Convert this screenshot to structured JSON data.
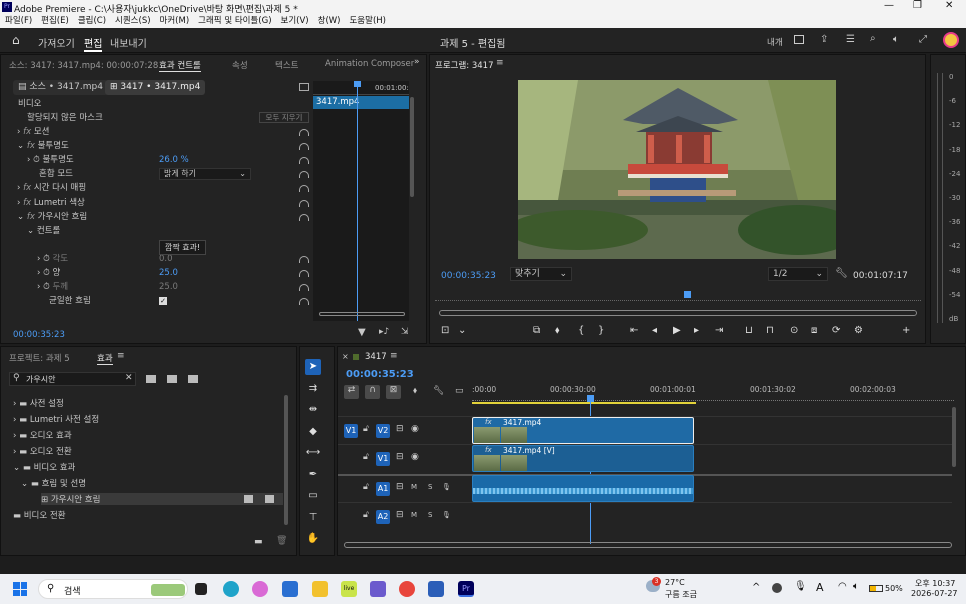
{
  "window": {
    "title": "Adobe Premiere - C:\\사용자\\jukkc\\OneDrive\\바탕 화면\\편집\\과제 5 *"
  },
  "menu": [
    "파일(F)",
    "편집(E)",
    "클립(C)",
    "시퀀스(S)",
    "마커(M)",
    "그래픽 및 타이틀(G)",
    "보기(V)",
    "창(W)",
    "도움말(H)"
  ],
  "header": {
    "nav": [
      "가져오기",
      "편집",
      "내보내기"
    ],
    "project_title": "과제 5 - 편집됨",
    "share": "내개"
  },
  "effect_controls": {
    "tabs": [
      "소스: 3417: 3417.mp4: 00:00:07:28",
      "효과 컨트롤",
      "속성",
      "텍스트",
      "Animation Composer"
    ],
    "source_tab": "소스 • 3417.mp4",
    "seq_tab": "3417 • 3417.mp4",
    "clip_label": "3417.mp4",
    "timecode_mini": "00:01:00:",
    "section": "비디오",
    "unassigned": "할당되지 않은 마스크",
    "remove_btn": "모두 지우기",
    "rows": [
      {
        "label": "모션",
        "fx": true
      },
      {
        "label": "불투명도",
        "fx": true
      },
      {
        "label": "불투명도",
        "value": "26.0 %"
      },
      {
        "label": "혼합 모드",
        "value": "밝게 하기"
      },
      {
        "label": "시간 다시 매핑",
        "fx": true
      },
      {
        "label": "Lumetri 색상",
        "fx": true
      },
      {
        "label": "가우시안 흐림",
        "fx": true
      },
      {
        "label": "컨트롤"
      },
      {
        "label": "각도",
        "value": "0.0"
      },
      {
        "label": "양",
        "value": "25.0"
      },
      {
        "label": "두께",
        "value": "25.0"
      },
      {
        "label": "균일한 흐림",
        "value": ""
      }
    ],
    "effect_button": "깜짝 효과!",
    "timecode": "00:00:35:23"
  },
  "program": {
    "title": "프로그램: 3417",
    "timecode": "00:00:35:23",
    "fit": "맞추기",
    "res": "1/2",
    "duration": "00:01:07:17",
    "meter": [
      "0",
      "-6",
      "-12",
      "-18",
      "-24",
      "-30",
      "-36",
      "-42",
      "-48",
      "-54",
      "dB"
    ]
  },
  "effects_panel": {
    "tabs": [
      "프로젝트: 과제 5",
      "효과"
    ],
    "search": "가우시안",
    "tree": [
      "사전 설정",
      "Lumetri 사전 설정",
      "오디오 효과",
      "오디오 전환",
      "비디오 효과",
      "흐림 및 선명",
      "가우시안 흐림",
      "비디오 전환"
    ]
  },
  "timeline": {
    "tab": "3417",
    "timecode": "00:00:35:23",
    "ruler": [
      ":00:00",
      "00:00:30:00",
      "00:01:00:01",
      "00:01:30:02",
      "00:02:00:03"
    ],
    "tracks": [
      "V2",
      "V1",
      "A1",
      "A2"
    ],
    "clips": {
      "v2": "3417.mp4",
      "v1": "3417.mp4 [V]"
    }
  },
  "taskbar": {
    "search": "검색",
    "weather_temp": "27°C",
    "weather_desc": "구름 조금",
    "battery": "50%",
    "time": "오후 10:37",
    "date": "2026-07-27",
    "badge": "3"
  }
}
